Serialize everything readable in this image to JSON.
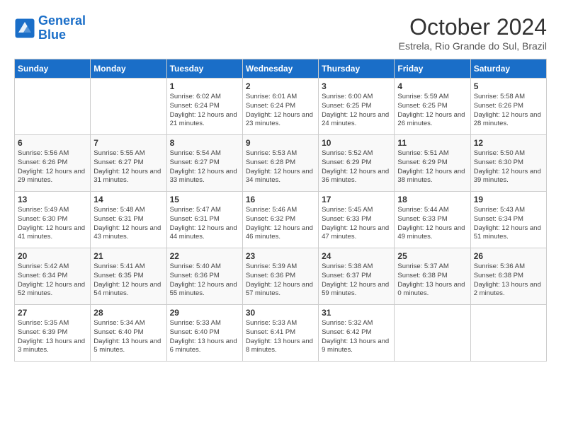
{
  "header": {
    "logo_line1": "General",
    "logo_line2": "Blue",
    "month_year": "October 2024",
    "location": "Estrela, Rio Grande do Sul, Brazil"
  },
  "weekdays": [
    "Sunday",
    "Monday",
    "Tuesday",
    "Wednesday",
    "Thursday",
    "Friday",
    "Saturday"
  ],
  "weeks": [
    [
      {
        "day": "",
        "info": ""
      },
      {
        "day": "",
        "info": ""
      },
      {
        "day": "1",
        "info": "Sunrise: 6:02 AM\nSunset: 6:24 PM\nDaylight: 12 hours\nand 21 minutes."
      },
      {
        "day": "2",
        "info": "Sunrise: 6:01 AM\nSunset: 6:24 PM\nDaylight: 12 hours\nand 23 minutes."
      },
      {
        "day": "3",
        "info": "Sunrise: 6:00 AM\nSunset: 6:25 PM\nDaylight: 12 hours\nand 24 minutes."
      },
      {
        "day": "4",
        "info": "Sunrise: 5:59 AM\nSunset: 6:25 PM\nDaylight: 12 hours\nand 26 minutes."
      },
      {
        "day": "5",
        "info": "Sunrise: 5:58 AM\nSunset: 6:26 PM\nDaylight: 12 hours\nand 28 minutes."
      }
    ],
    [
      {
        "day": "6",
        "info": "Sunrise: 5:56 AM\nSunset: 6:26 PM\nDaylight: 12 hours\nand 29 minutes."
      },
      {
        "day": "7",
        "info": "Sunrise: 5:55 AM\nSunset: 6:27 PM\nDaylight: 12 hours\nand 31 minutes."
      },
      {
        "day": "8",
        "info": "Sunrise: 5:54 AM\nSunset: 6:27 PM\nDaylight: 12 hours\nand 33 minutes."
      },
      {
        "day": "9",
        "info": "Sunrise: 5:53 AM\nSunset: 6:28 PM\nDaylight: 12 hours\nand 34 minutes."
      },
      {
        "day": "10",
        "info": "Sunrise: 5:52 AM\nSunset: 6:29 PM\nDaylight: 12 hours\nand 36 minutes."
      },
      {
        "day": "11",
        "info": "Sunrise: 5:51 AM\nSunset: 6:29 PM\nDaylight: 12 hours\nand 38 minutes."
      },
      {
        "day": "12",
        "info": "Sunrise: 5:50 AM\nSunset: 6:30 PM\nDaylight: 12 hours\nand 39 minutes."
      }
    ],
    [
      {
        "day": "13",
        "info": "Sunrise: 5:49 AM\nSunset: 6:30 PM\nDaylight: 12 hours\nand 41 minutes."
      },
      {
        "day": "14",
        "info": "Sunrise: 5:48 AM\nSunset: 6:31 PM\nDaylight: 12 hours\nand 43 minutes."
      },
      {
        "day": "15",
        "info": "Sunrise: 5:47 AM\nSunset: 6:31 PM\nDaylight: 12 hours\nand 44 minutes."
      },
      {
        "day": "16",
        "info": "Sunrise: 5:46 AM\nSunset: 6:32 PM\nDaylight: 12 hours\nand 46 minutes."
      },
      {
        "day": "17",
        "info": "Sunrise: 5:45 AM\nSunset: 6:33 PM\nDaylight: 12 hours\nand 47 minutes."
      },
      {
        "day": "18",
        "info": "Sunrise: 5:44 AM\nSunset: 6:33 PM\nDaylight: 12 hours\nand 49 minutes."
      },
      {
        "day": "19",
        "info": "Sunrise: 5:43 AM\nSunset: 6:34 PM\nDaylight: 12 hours\nand 51 minutes."
      }
    ],
    [
      {
        "day": "20",
        "info": "Sunrise: 5:42 AM\nSunset: 6:34 PM\nDaylight: 12 hours\nand 52 minutes."
      },
      {
        "day": "21",
        "info": "Sunrise: 5:41 AM\nSunset: 6:35 PM\nDaylight: 12 hours\nand 54 minutes."
      },
      {
        "day": "22",
        "info": "Sunrise: 5:40 AM\nSunset: 6:36 PM\nDaylight: 12 hours\nand 55 minutes."
      },
      {
        "day": "23",
        "info": "Sunrise: 5:39 AM\nSunset: 6:36 PM\nDaylight: 12 hours\nand 57 minutes."
      },
      {
        "day": "24",
        "info": "Sunrise: 5:38 AM\nSunset: 6:37 PM\nDaylight: 12 hours\nand 59 minutes."
      },
      {
        "day": "25",
        "info": "Sunrise: 5:37 AM\nSunset: 6:38 PM\nDaylight: 13 hours\nand 0 minutes."
      },
      {
        "day": "26",
        "info": "Sunrise: 5:36 AM\nSunset: 6:38 PM\nDaylight: 13 hours\nand 2 minutes."
      }
    ],
    [
      {
        "day": "27",
        "info": "Sunrise: 5:35 AM\nSunset: 6:39 PM\nDaylight: 13 hours\nand 3 minutes."
      },
      {
        "day": "28",
        "info": "Sunrise: 5:34 AM\nSunset: 6:40 PM\nDaylight: 13 hours\nand 5 minutes."
      },
      {
        "day": "29",
        "info": "Sunrise: 5:33 AM\nSunset: 6:40 PM\nDaylight: 13 hours\nand 6 minutes."
      },
      {
        "day": "30",
        "info": "Sunrise: 5:33 AM\nSunset: 6:41 PM\nDaylight: 13 hours\nand 8 minutes."
      },
      {
        "day": "31",
        "info": "Sunrise: 5:32 AM\nSunset: 6:42 PM\nDaylight: 13 hours\nand 9 minutes."
      },
      {
        "day": "",
        "info": ""
      },
      {
        "day": "",
        "info": ""
      }
    ]
  ]
}
